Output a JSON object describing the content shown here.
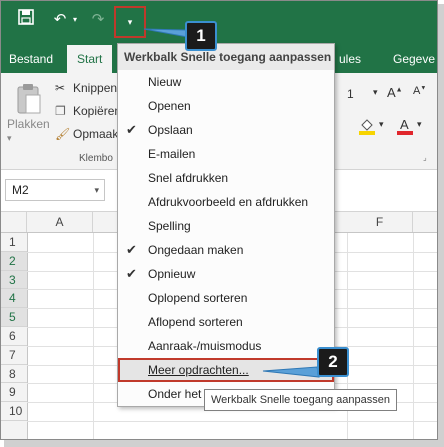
{
  "ribbon": {
    "tabs": [
      "Bestand",
      "Start",
      "ules",
      "Gegeve"
    ],
    "clipboard": {
      "paste_label": "Plakken",
      "cut_label": "Knippen",
      "copy_label": "Kopiëren",
      "painter_label": "Opmaak",
      "group_label": "Klembo"
    },
    "font_size": "1"
  },
  "formula_bar": {
    "namebox_value": "M2"
  },
  "grid": {
    "columns": [
      "A",
      "F"
    ],
    "rows": [
      "1",
      "2",
      "3",
      "4",
      "5",
      "6",
      "7",
      "8",
      "9",
      "10"
    ],
    "selected_rows": [
      "2",
      "3",
      "4",
      "5"
    ]
  },
  "menu": {
    "title": "Werkbalk Snelle toegang aanpassen",
    "items": [
      {
        "label": "Nieuw",
        "checked": false
      },
      {
        "label": "Openen",
        "checked": false
      },
      {
        "label": "Opslaan",
        "checked": true
      },
      {
        "label": "E-mailen",
        "checked": false
      },
      {
        "label": "Snel afdrukken",
        "checked": false
      },
      {
        "label": "Afdrukvoorbeeld en afdrukken",
        "checked": false
      },
      {
        "label": "Spelling",
        "checked": false
      },
      {
        "label": "Ongedaan maken",
        "checked": true
      },
      {
        "label": "Opnieuw",
        "checked": true
      },
      {
        "label": "Oplopend sorteren",
        "checked": false
      },
      {
        "label": "Aflopend sorteren",
        "checked": false
      },
      {
        "label": "Aanraak-/muismodus",
        "checked": false
      },
      {
        "label": "Meer opdrachten...",
        "checked": false
      },
      {
        "label": "Onder het",
        "checked": false
      }
    ]
  },
  "tooltip": "Werkbalk Snelle toegang aanpassen",
  "callouts": [
    "1",
    "2"
  ],
  "colors": {
    "accent": "#217346",
    "highlight": "#c0392b",
    "callout_border": "#3a8fd0"
  }
}
